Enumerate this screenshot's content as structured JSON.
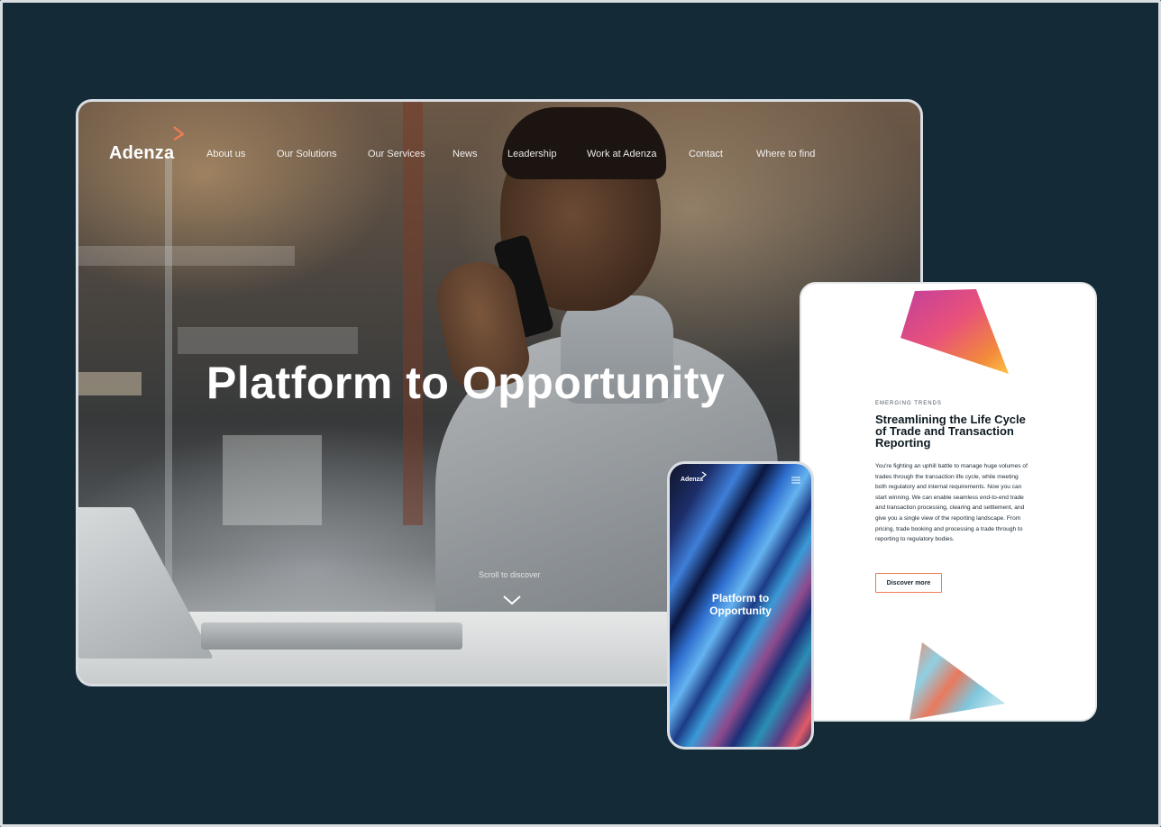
{
  "colors": {
    "background": "#142a36",
    "accent": "#f07b54",
    "white": "#ffffff"
  },
  "desktop": {
    "logo": "Adenza",
    "nav": [
      {
        "label": "About us"
      },
      {
        "label": "Our Solutions"
      },
      {
        "label": "Our Services"
      },
      {
        "label": "News"
      },
      {
        "label": "Leadership"
      },
      {
        "label": "Work at Adenza"
      },
      {
        "label": "Contact"
      },
      {
        "label": "Where to find"
      }
    ],
    "hero_title": "Platform to Opportunity",
    "scroll_label": "Scroll to discover",
    "scroll_icon": "chevron-down-icon"
  },
  "tablet": {
    "eyebrow": "EMERGING TRENDS",
    "title": "Streamlining the Life Cycle of Trade and Transaction Reporting",
    "body": "You're fighting an uphill battle to manage huge volumes of trades through the transaction life cycle, while meeting both regulatory and internal requirements. Now you can start winning. We can enable seamless end-to-end trade and transaction processing, clearing and settlement, and give you a single view of the reporting landscape. From pricing, trade booking and processing a trade through to reporting to regulatory bodies.",
    "cta": "Discover more"
  },
  "phone": {
    "logo": "Adenza",
    "title_line1": "Platform to",
    "title_line2": "Opportunity",
    "menu_icon": "menu-icon"
  }
}
